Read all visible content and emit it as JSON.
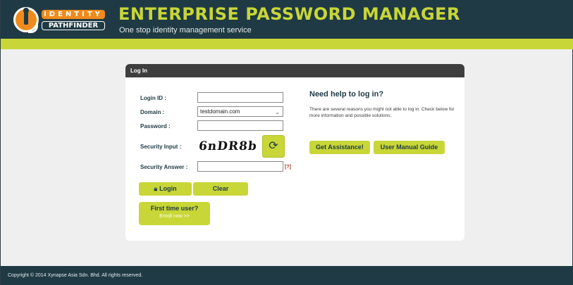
{
  "header": {
    "logo_top": "IDENTITY",
    "logo_bottom": "PATHFINDER",
    "title": "ENTERPRISE PASSWORD MANAGER",
    "subtitle": "One stop identity management service"
  },
  "login": {
    "panel_title": "Log In",
    "login_id_label": "Login ID :",
    "login_id_value": "",
    "domain_label": "Domain :",
    "domain_value": "testdomain.com",
    "password_label": "Password :",
    "password_value": "",
    "security_input_label": "Security Input :",
    "captcha_text": "6nDR8b",
    "security_answer_label": "Security Answer :",
    "security_answer_value": "",
    "help_marker": "[?]",
    "login_button": "Login",
    "clear_button": "Clear",
    "first_time_title": "First time user?",
    "first_time_link": "Enroll now >>"
  },
  "help_section": {
    "title": "Need help to log in?",
    "text": "There are several reasons you might not able to log in. Check below for more information and possible solutions.",
    "assistance_button": "Get Assistance!",
    "manual_button": "User Manual Guide"
  },
  "footer": {
    "copyright": "Copyright © 2014 Xynapse Asia Sdn. Bhd. All rights reserved."
  },
  "colors": {
    "header_bg": "#1f3a44",
    "accent_lime": "#c8d637",
    "logo_orange": "#f08a1c",
    "panel_header": "#3e3e3e",
    "page_bg": "#efefef"
  },
  "icons": {
    "refresh": "refresh-icon",
    "lock": "lock-icon",
    "dropdown": "chevron-down-icon"
  }
}
